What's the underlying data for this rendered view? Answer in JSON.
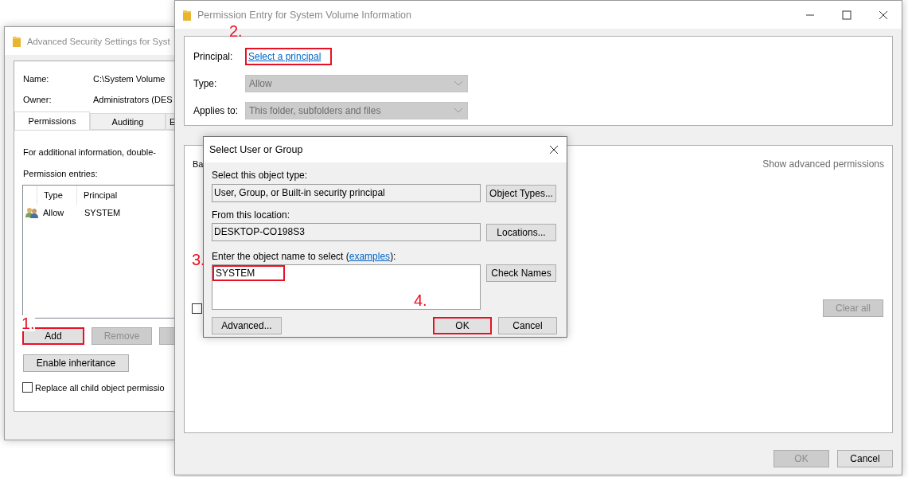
{
  "security_window": {
    "title": "Advanced Security Settings for Syst",
    "name_label": "Name:",
    "name_value": "C:\\System Volume",
    "owner_label": "Owner:",
    "owner_value": "Administrators (DES",
    "tabs": [
      {
        "label": "Permissions",
        "selected": true
      },
      {
        "label": "Auditing",
        "selected": false
      },
      {
        "label": "E",
        "selected": false
      }
    ],
    "info": "For additional information, double-",
    "entries_label": "Permission entries:",
    "columns": [
      "Type",
      "Principal"
    ],
    "rows": [
      {
        "type": "Allow",
        "principal": "SYSTEM"
      }
    ],
    "buttons": [
      {
        "label": "Add",
        "disabled": false,
        "highlighted": true
      },
      {
        "label": "Remove",
        "disabled": true,
        "highlighted": false
      }
    ],
    "enable_inheritance": "Enable inheritance",
    "replace_checkbox": {
      "label": "Replace all child object permissio",
      "checked": false
    }
  },
  "entry_window": {
    "title": "Permission Entry for System Volume Information",
    "principal_label": "Principal:",
    "principal_link": {
      "label": "Select a principal",
      "highlighted": true
    },
    "type_label": "Type:",
    "type_value": "Allow",
    "applies_label": "Applies to:",
    "applies_value": "This folder, subfolders and files",
    "basic_label": "Ba",
    "show_advanced": "Show advanced permissions",
    "checkbox": {
      "checked": false
    },
    "clear_all": {
      "label": "Clear all",
      "disabled": true
    },
    "buttons": [
      {
        "label": "OK",
        "disabled": true
      },
      {
        "label": "Cancel",
        "disabled": false
      }
    ]
  },
  "select_dialog": {
    "title": "Select User or Group",
    "object_type_label": "Select this object type:",
    "object_type_value": "User, Group, or Built-in security principal",
    "object_types_button": "Object Types...",
    "location_label": "From this location:",
    "location_value": "DESKTOP-CO198S3",
    "locations_button": "Locations...",
    "name_prompt": {
      "before": "Enter the object name to select (",
      "link": "examples",
      "after": "):"
    },
    "name_value": {
      "text": "SYSTEM",
      "highlighted": true
    },
    "check_names_button": "Check Names",
    "advanced_button": "Advanced...",
    "buttons": [
      {
        "label": "OK",
        "highlighted": true
      },
      {
        "label": "Cancel",
        "highlighted": false
      }
    ]
  },
  "annotations": [
    {
      "label": "1."
    },
    {
      "label": "2."
    },
    {
      "label": "3."
    },
    {
      "label": "4."
    }
  ]
}
